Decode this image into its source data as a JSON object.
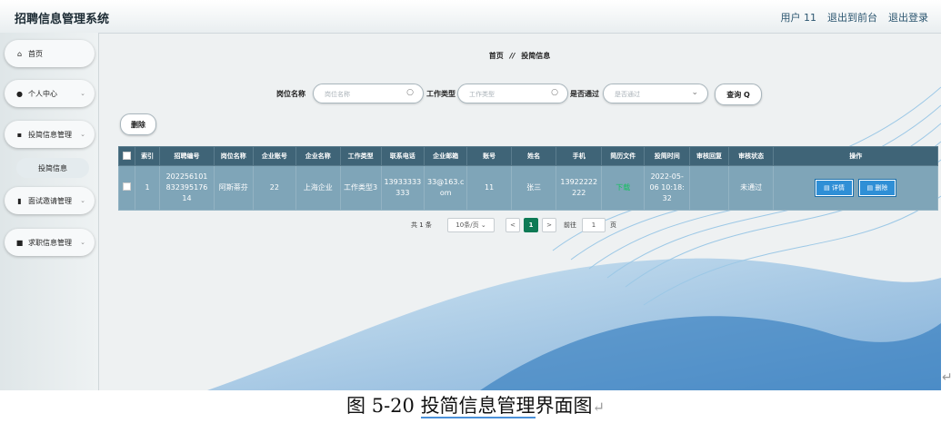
{
  "app": {
    "title": "招聘信息管理系统"
  },
  "topbar": {
    "user": "用户 11",
    "back_front": "退出到前台",
    "logout": "退出登录"
  },
  "sidebar": {
    "items": [
      {
        "icon": "home-icon",
        "label": "首页"
      },
      {
        "icon": "user-icon",
        "label": "个人中心"
      },
      {
        "icon": "grid-icon",
        "label": "投简信息管理"
      },
      {
        "icon": "chart-icon",
        "label": "面试邀请管理"
      },
      {
        "icon": "card-icon",
        "label": "求职信息管理"
      }
    ],
    "sub_item": "投简信息",
    "chevron": "⌄"
  },
  "breadcrumb": {
    "home": "首页",
    "sep": "//",
    "current": "投简信息"
  },
  "search": {
    "job_label": "岗位名称",
    "job_placeholder": "岗位名称",
    "type_label": "工作类型",
    "type_placeholder": "工作类型",
    "pass_label": "是否通过",
    "pass_placeholder": "是否通过",
    "query": "查询 Q"
  },
  "actions": {
    "delete": "删除"
  },
  "table": {
    "headers": [
      "索引",
      "招聘编号",
      "岗位名称",
      "企业账号",
      "企业名称",
      "工作类型",
      "联系电话",
      "企业邮箱",
      "账号",
      "姓名",
      "手机",
      "简历文件",
      "投简时间",
      "审核回复",
      "审核状态",
      "操作"
    ],
    "row": {
      "index": "1",
      "recruit_no": "20225610183239517614",
      "recruit_no_lines": [
        "202256101",
        "832395176",
        "14"
      ],
      "job": "阿斯蒂芬",
      "company_acct": "22",
      "company": "上海企业",
      "job_type": "工作类型3",
      "phone_lines": [
        "13933333",
        "333"
      ],
      "email_lines": [
        "33@163.c",
        "om"
      ],
      "account": "11",
      "name": "张三",
      "mobile_lines": [
        "13922222",
        "222"
      ],
      "resume": "下载",
      "time_lines": [
        "2022-05-",
        "06 10:18:",
        "32"
      ],
      "reply": "",
      "status": "未通过",
      "detail": "详情",
      "remove": "删除"
    }
  },
  "pager": {
    "total": "共 1 条",
    "page_size": "10条/页",
    "prev": "<",
    "current": "1",
    "next": ">",
    "goto": "前往",
    "goto_value": "1",
    "page_unit": "页"
  },
  "caption": {
    "prefix": "图 5-20 ",
    "underlined": "投简信息管理",
    "suffix": "界面图",
    "mark": "↵"
  },
  "colors": {
    "header": "#3f6477",
    "row": "#7fa5b8",
    "accent": "#2f8fd6",
    "pager_active": "#0d7a55"
  }
}
